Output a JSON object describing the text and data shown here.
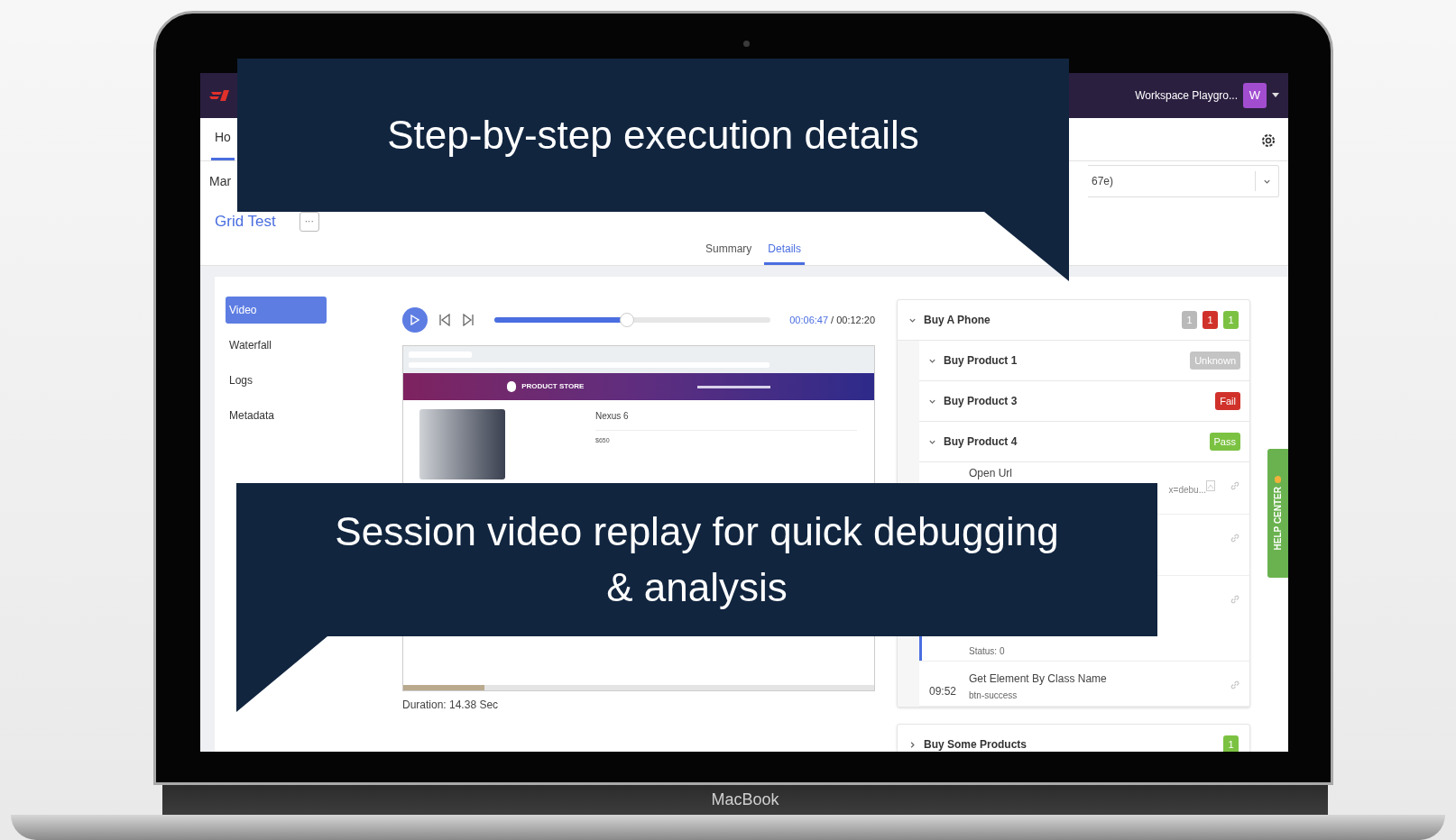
{
  "laptop_label": "MacBook",
  "nav": {
    "workspace": "Workspace Playgro...",
    "avatar": "W"
  },
  "tabs": [
    {
      "label": "Ho",
      "selected": true
    }
  ],
  "breadcrumb": "Mar",
  "run_select": {
    "value": "67e)"
  },
  "test": {
    "name": "Grid Test",
    "more": "···"
  },
  "view_tabs": [
    {
      "label": "Summary",
      "selected": false
    },
    {
      "label": "Details",
      "selected": true
    }
  ],
  "side_menu": [
    {
      "label": "Video",
      "selected": true
    },
    {
      "label": "Waterfall",
      "selected": false
    },
    {
      "label": "Logs",
      "selected": false
    },
    {
      "label": "Metadata",
      "selected": false
    }
  ],
  "player": {
    "current": "00:06:47",
    "total": "/ 00:12:20",
    "level": 0.48,
    "duration": "Duration: 14.38 Sec",
    "frame": {
      "store": "PRODUCT STORE",
      "product": "Nexus 6",
      "price": "$650"
    }
  },
  "tree": [
    {
      "title": "Buy A Phone",
      "expanded": true,
      "counts": [
        {
          "value": "1",
          "color": "#b9b9b9"
        },
        {
          "value": "1",
          "color": "#d0322b"
        },
        {
          "value": "1",
          "color": "#7cc242"
        }
      ],
      "children": [
        {
          "title": "Buy Product 1",
          "expanded": true,
          "status": "Unknown",
          "color": "#c4c4c4"
        },
        {
          "title": "Buy Product 3",
          "expanded": true,
          "status": "Fail",
          "color": "#d0322b"
        },
        {
          "title": "Buy Product 4",
          "expanded": true,
          "status": "Pass",
          "color": "#7cc242"
        }
      ],
      "steps": [
        {
          "name": "Open Url",
          "detail_end": "x=debu...",
          "screenshot": true
        },
        {
          "screenshot": false
        },
        {
          "detail": "Status: 0",
          "screenshot": false,
          "active": true
        },
        {
          "time": "09:52",
          "name": "Get Element By Class Name",
          "detail": "btn-success",
          "screenshot": false
        }
      ]
    },
    {
      "title": "Buy Some Products",
      "expanded": false,
      "counts": [
        {
          "value": "1",
          "color": "#7cc242"
        }
      ]
    }
  ],
  "help_tab": "HELP CENTER",
  "callouts": [
    {
      "text": "Step-by-step execution details",
      "kind": "tail-top-right"
    },
    {
      "text": "Session video replay for quick debugging & analysis",
      "kind": "tail-bottom-left"
    }
  ]
}
